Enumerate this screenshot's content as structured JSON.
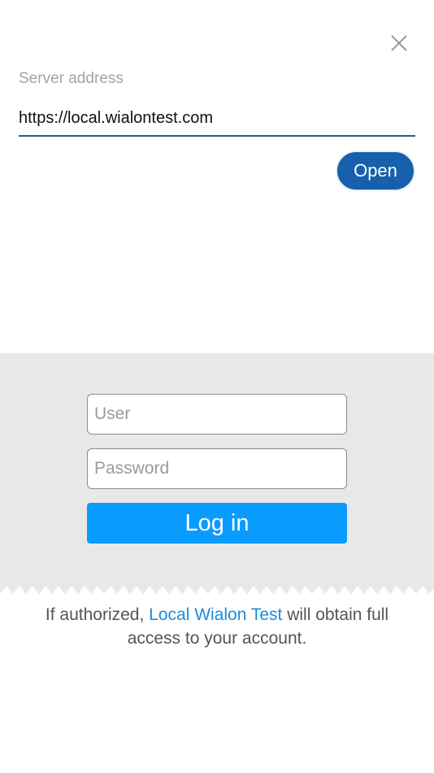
{
  "header": {
    "close_icon": "close-icon"
  },
  "server": {
    "label": "Server address",
    "value": "https://local.wialontest.com",
    "open_label": "Open"
  },
  "login": {
    "user_placeholder": "User",
    "password_placeholder": "Password",
    "login_label": "Log in"
  },
  "notice": {
    "prefix": "If authorized, ",
    "link": "Local Wialon Test",
    "suffix_line1": " will obtain full",
    "line2": "access to your account."
  },
  "colors": {
    "accent_dark": "#1660ac",
    "accent_light": "#0a9bff",
    "link": "#1a8ce0",
    "panel_bg": "#e8e8e8"
  }
}
